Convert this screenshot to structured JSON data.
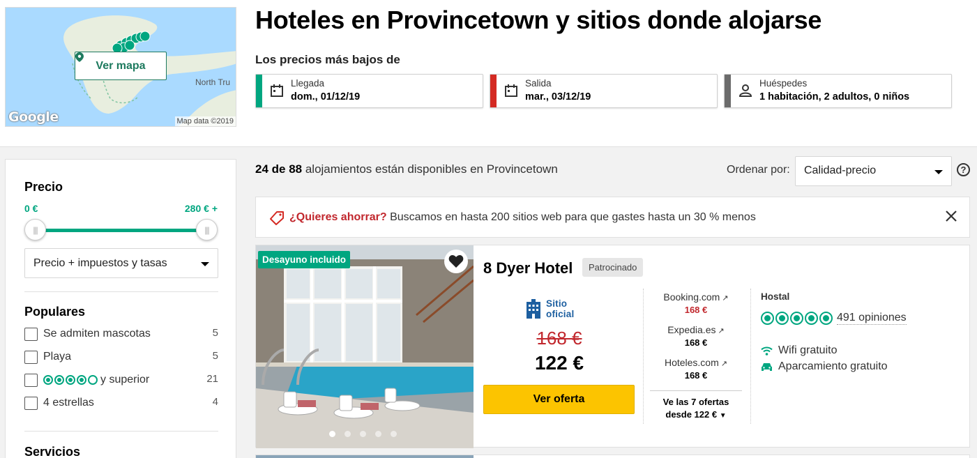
{
  "map": {
    "button_label": "Ver mapa",
    "google_label": "Google",
    "map_data": "Map data ©2019",
    "town_label": "North Tru"
  },
  "header": {
    "title": "Hoteles en Provincetown y sitios donde alojarse",
    "lowest_prices": "Los precios más bajos de",
    "checkin_label": "Llegada",
    "checkin_value": "dom., 01/12/19",
    "checkout_label": "Salida",
    "checkout_value": "mar., 03/12/19",
    "guests_label": "Huéspedes",
    "guests_value": "1 habitación, 2 adultos, 0 niños",
    "colors": {
      "checkin": "#00a680",
      "checkout": "#d42a23",
      "guests": "#6b6b6b"
    }
  },
  "filters": {
    "price_heading": "Precio",
    "price_min": "0 €",
    "price_max": "280 € +",
    "price_mode": "Precio + impuestos y tasas",
    "popular_heading": "Populares",
    "popular_items": [
      {
        "label": "Se admiten mascotas",
        "count": "5"
      },
      {
        "label": "Playa",
        "count": "5"
      },
      {
        "label": "y superior",
        "count": "21"
      },
      {
        "label": "4 estrellas",
        "count": "4"
      }
    ],
    "services_heading": "Servicios"
  },
  "results": {
    "count_shown": "24 de 88",
    "count_text": "alojamientos están disponibles en Provincetown",
    "sort_label": "Ordenar por:",
    "sort_value": "Calidad-precio",
    "help_icon": "?"
  },
  "promo": {
    "highlight": "¿Quieres ahorrar?",
    "text": "Buscamos en hasta 200 sitios web para que gastes hasta un 30 % menos"
  },
  "hotel": {
    "badge": "Desayuno incluido",
    "name": "8 Dyer Hotel",
    "sponsored": "Patrocinado",
    "official_line1": "Sitio",
    "official_line2": "oficial",
    "old_price": "168 €",
    "price": "122 €",
    "cta": "Ver oferta",
    "other_offers": [
      {
        "site": "Booking.com",
        "price": "168 €"
      },
      {
        "site": "Expedia.es",
        "price": "168 €"
      },
      {
        "site": "Hoteles.com",
        "price": "168 €"
      }
    ],
    "more_line1": "Ve las 7 ofertas",
    "more_line2": "desde 122 €",
    "type": "Hostal",
    "rating_bubbles": 5,
    "reviews": "491 opiniones",
    "amenities": [
      "Wifi gratuito",
      "Aparcamiento gratuito"
    ],
    "photo_count": 5,
    "photo_active": 1
  }
}
